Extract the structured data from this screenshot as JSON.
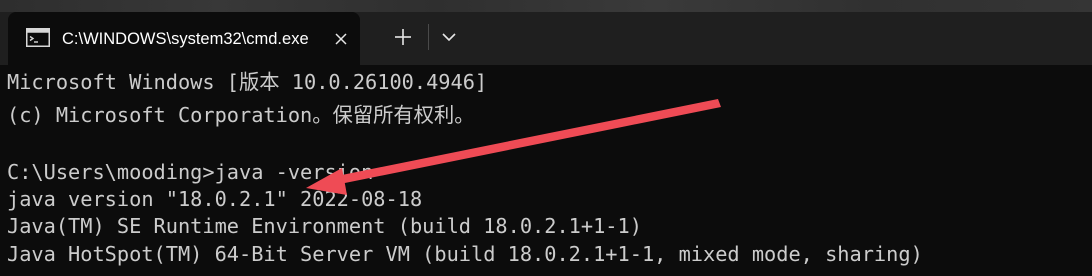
{
  "window": {
    "tab_title": "C:\\WINDOWS\\system32\\cmd.exe",
    "tab_icon": "cmd-icon"
  },
  "tabbar": {
    "close_icon": "close-icon",
    "new_tab_icon": "plus-icon",
    "dropdown_icon": "chevron-down-icon"
  },
  "terminal": {
    "lines": [
      "Microsoft Windows [版本 10.0.26100.4946]",
      "(c) Microsoft Corporation。保留所有权利。",
      "",
      "C:\\Users\\mooding>java -version",
      "java version \"18.0.2.1\" 2022-08-18",
      "Java(TM) SE Runtime Environment (build 18.0.2.1+1-1)",
      "Java HotSpot(TM) 64-Bit Server VM (build 18.0.2.1+1-1, mixed mode, sharing)"
    ]
  },
  "annotation": {
    "arrow_color": "#ef4b55"
  },
  "colors": {
    "terminal_bg": "#0c0c0c",
    "terminal_text": "#cccccc",
    "titlebar_bg": "#1f1f1f"
  }
}
